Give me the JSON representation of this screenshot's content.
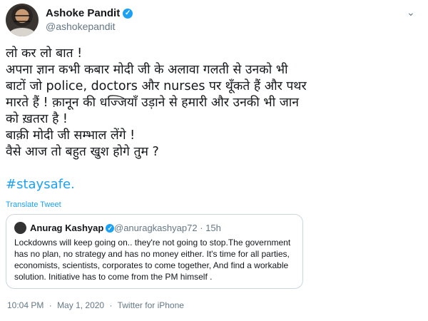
{
  "author": {
    "name": "Ashoke Pandit",
    "handle": "@ashokepandit"
  },
  "tweet": {
    "lines": [
      "लो कर लो बात !",
      "अपना ज्ञान कभी कबार मोदी जी के अलावा गलती से उनको भी",
      "बाटों जो police, doctors और nurses पर थूँकते हैं और पथर",
      "मारते हैं ! क़ानून की धज्जियाँ उड़ाने से हमारी और उनकी भी जान",
      "को ख़तरा है !",
      "बाक़ी मोदी जी सम्भाल लेंगे !",
      "वैसे आज तो बहुत खुश होगे तुम ?"
    ],
    "hashtag": "#staysafe.",
    "translate": "Translate Tweet"
  },
  "quoted": {
    "name": "Anurag Kashyap",
    "handle": "@anuragkashyap72",
    "time": "15h",
    "text": "Lockdowns will keep going on.. they're not going to stop.The government has no plan, no strategy and has no money either. It's time for all parties, economists, scientists, corporates to come together, And find a workable solution. Initiative has to come from the PM himself ."
  },
  "footer": {
    "time": "10:04 PM",
    "date": "May 1, 2020",
    "source": "Twitter for iPhone"
  },
  "colors": {
    "accent": "#1da1f2",
    "muted": "#657786",
    "text": "#14171a",
    "border": "#ccd6dd"
  },
  "icons": {
    "verified": "verified-badge-icon",
    "caret": "chevron-down-icon"
  }
}
